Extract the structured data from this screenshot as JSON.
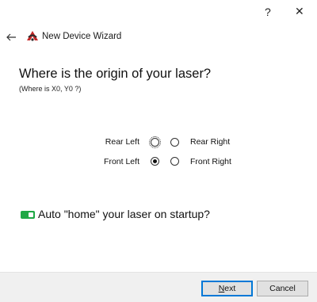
{
  "titlebar": {
    "help_label": "?",
    "close_label": "✕"
  },
  "header": {
    "back_icon": "arrow-left-icon",
    "logo_icon": "app-logo-icon",
    "title": "New Device Wizard"
  },
  "main": {
    "heading": "Where is the origin of your laser?",
    "subheading": "(Where is X0, Y0 ?)",
    "origin_options": {
      "rear_left": "Rear Left",
      "rear_right": "Rear Right",
      "front_left": "Front Left",
      "front_right": "Front Right"
    },
    "selected_origin": "Front Left",
    "auto_home": {
      "label": "Auto \"home\" your laser on startup?",
      "enabled": true,
      "color": "#1fa845"
    }
  },
  "footer": {
    "next_mnemonic": "N",
    "next_rest": "ext",
    "cancel_label": "Cancel",
    "accent_color": "#0078d7"
  }
}
